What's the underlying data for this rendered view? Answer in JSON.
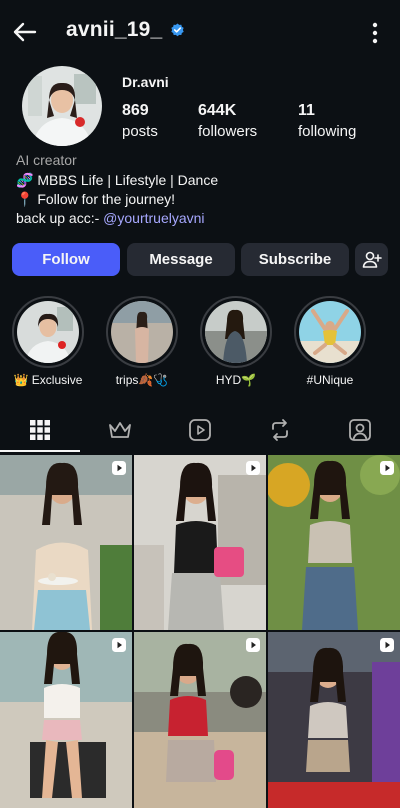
{
  "header": {
    "username": "avnii_19_",
    "icons": [
      "back-arrow-icon",
      "verified-badge-icon",
      "more-vertical-icon"
    ]
  },
  "profile": {
    "display_name": "Dr.avni",
    "stats": [
      {
        "value": "869",
        "label": "posts"
      },
      {
        "value": "644K",
        "label": "followers"
      },
      {
        "value": "11",
        "label": "following"
      }
    ],
    "category": "AI creator",
    "bio_lines": [
      "🧬 MBBS Life | Lifestyle | Dance",
      "📍 Follow for the journey!"
    ],
    "backup_prefix": "back up acc:- ",
    "backup_mention": "@yourtruelyavni"
  },
  "actions": {
    "follow": "Follow",
    "message": "Message",
    "subscribe": "Subscribe",
    "add_user_icon": "add-person-icon"
  },
  "highlights": [
    {
      "label": "👑 Exclusive"
    },
    {
      "label": "trips🍂🩺"
    },
    {
      "label": "HYD🌱"
    },
    {
      "label": "#UNique"
    }
  ],
  "tabs": [
    "grid-icon",
    "crown-icon",
    "reels-icon",
    "repost-icon",
    "tagged-icon"
  ],
  "grid_posts": [
    {
      "kind": "reel"
    },
    {
      "kind": "reel"
    },
    {
      "kind": "reel"
    },
    {
      "kind": "reel"
    },
    {
      "kind": "reel"
    },
    {
      "kind": "reel"
    }
  ],
  "colors": {
    "background": "#0c1014",
    "follow_button": "#4a5df9",
    "secondary_button": "#262a33",
    "mention": "#a7a8ff",
    "verified": "#3897f0"
  }
}
